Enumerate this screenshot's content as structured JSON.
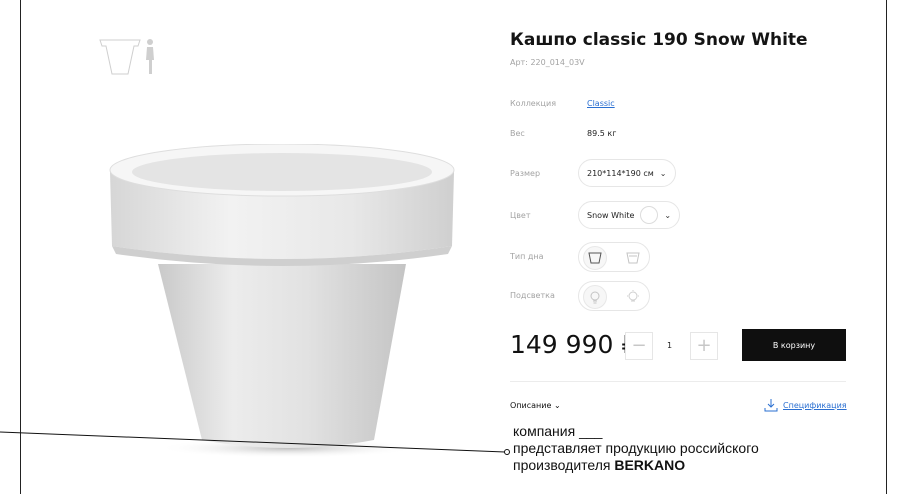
{
  "product": {
    "title": "Кашпо classic 190 Snow White",
    "article": "Арт: 220_014_03V"
  },
  "specs": {
    "collection_label": "Коллекция",
    "collection_value": "Classic",
    "weight_label": "Вес",
    "weight_value": "89.5 кг",
    "size_label": "Размер",
    "size_value": "210*114*190 см",
    "color_label": "Цвет",
    "color_value": "Snow White",
    "color_swatch": "#ffffff",
    "bottom_label": "Тип дна",
    "light_label": "Подсветка"
  },
  "purchase": {
    "price": "149 990 ₽",
    "quantity": "1",
    "minus": "−",
    "plus": "+",
    "cart_label": "В корзину"
  },
  "description": {
    "toggle_label": "Описание",
    "spec_link": "Спецификация"
  },
  "callout": {
    "line1": "компания ___",
    "line2": "представляет продукцию российского",
    "line3_prefix": "производителя ",
    "line3_brand": "BERKANO"
  },
  "icons": {
    "size": "size-reference-icon",
    "chevron": "chevron-down-icon",
    "bottom_open": "open-bottom-icon",
    "bottom_closed": "drainage-bottom-icon",
    "light_off": "bulb-off-icon",
    "light_on": "bulb-on-icon",
    "download": "download-icon"
  },
  "colors": {
    "accent_link": "#2a6fd1",
    "cart_button": "#0f0f0f",
    "muted_text": "#a3a3a3"
  }
}
